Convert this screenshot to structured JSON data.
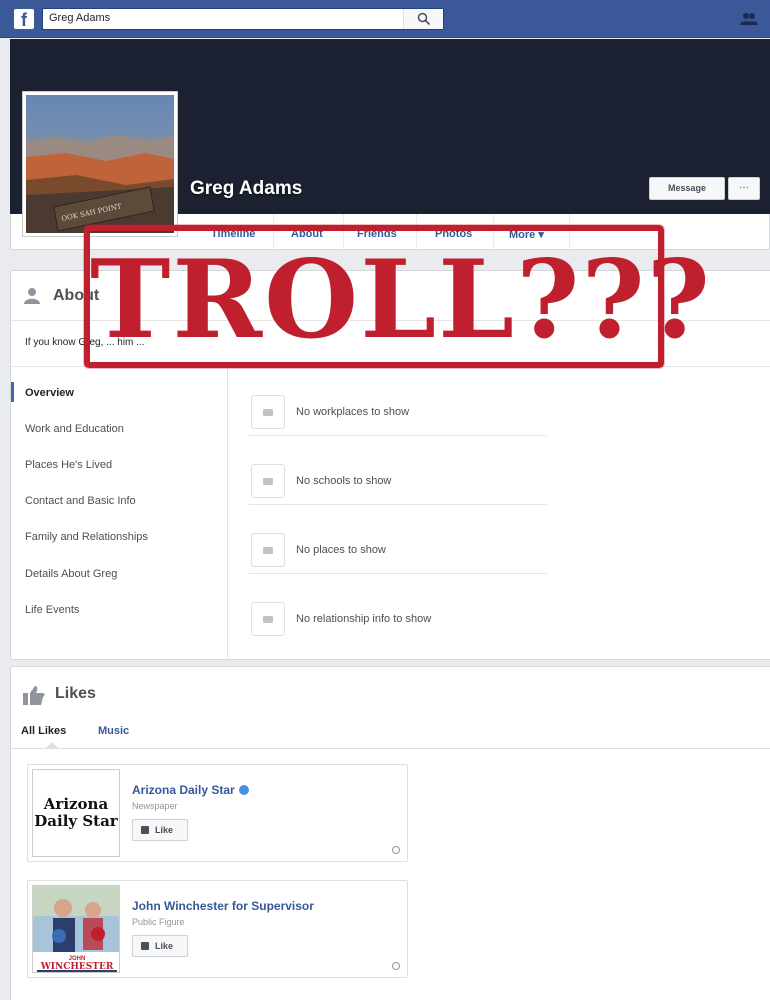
{
  "topbar": {
    "logo": "f",
    "search_value": "Greg Adams",
    "search_icon": "search-icon",
    "friends_icon": "friend-requests-icon",
    "accent": "#3b5998"
  },
  "profile": {
    "name": "Greg Adams",
    "pic_sign": "OOK SAH POINT",
    "message_label": "Message",
    "more_label": "···"
  },
  "nav": {
    "tabs": [
      "Timeline",
      "About",
      "Friends",
      "Photos",
      "More ▾"
    ]
  },
  "about": {
    "title": "About",
    "hint": "If you know Greg, ... him ...",
    "sidebar": [
      "Overview",
      "Work and Education",
      "Places He's Lived",
      "Contact and Basic Info",
      "Family and Relationships",
      "Details About Greg",
      "Life Events"
    ],
    "overview_rows": [
      {
        "icon": "briefcase-icon",
        "text": "No workplaces to show"
      },
      {
        "icon": "graduation-cap-icon",
        "text": "No schools to show"
      },
      {
        "icon": "location-pin-icon",
        "text": "No places to show"
      },
      {
        "icon": "heart-icon",
        "text": "No relationship info to show"
      }
    ]
  },
  "likes": {
    "title": "Likes",
    "tabs": [
      "All Likes",
      "Music"
    ],
    "items": [
      {
        "name": "Arizona Daily Star",
        "category": "Newspaper",
        "like_label": "Like",
        "verified": true,
        "thumb_text": [
          "Arizona",
          "Daily Star"
        ]
      },
      {
        "name": "John Winchester for Supervisor",
        "category": "Public Figure",
        "like_label": "Like",
        "verified": false,
        "thumb_text": [
          "JOHN",
          "WINCHESTER"
        ]
      }
    ]
  },
  "overlay": {
    "stamp_text": "TROLL???",
    "color": "#c0202e"
  }
}
